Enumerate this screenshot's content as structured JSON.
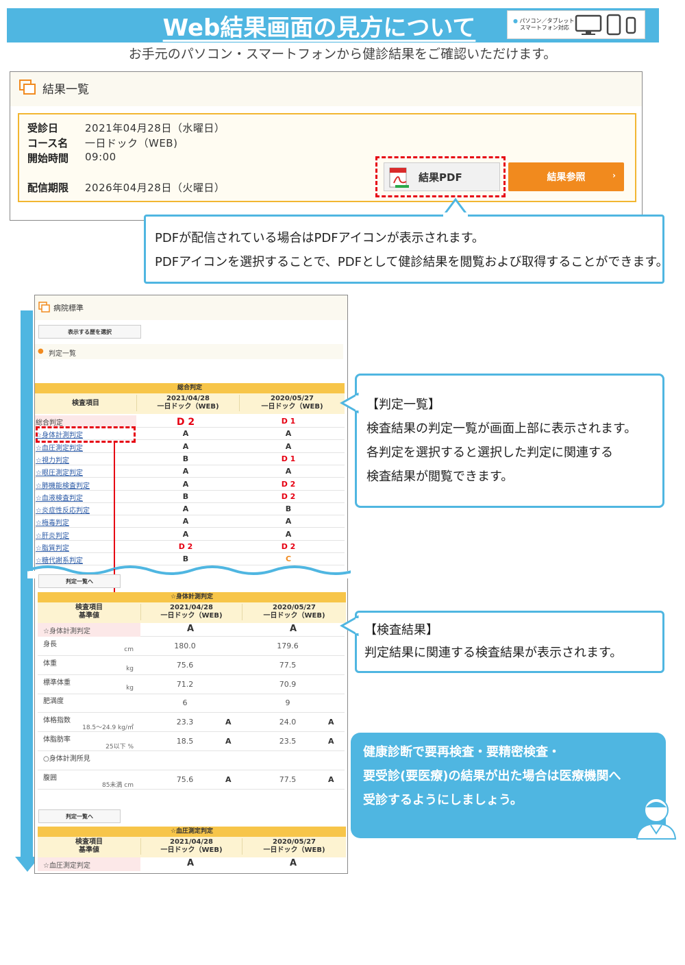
{
  "header": {
    "title": "Web結果画面の見方について",
    "badge": [
      "パソコン／タブレット",
      "スマートフォン対応"
    ],
    "subtitle": "お手元のパソコン・スマートフォンから健診結果をご確認いただけます。"
  },
  "panel1": {
    "title": "結果一覧",
    "rows": [
      {
        "label": "受診日",
        "value": "2021年04月28日（水曜日）"
      },
      {
        "label": "コース名",
        "value": "一日ドック（WEB)"
      },
      {
        "label": "開始時間",
        "value": "09:00"
      },
      {
        "label": "配信期限",
        "value": "2026年04月28日（火曜日）"
      }
    ],
    "pdf_button": "結果PDF",
    "ref_button": "結果参照",
    "ref_arrow": "›"
  },
  "callout1": {
    "lines": [
      "PDFが配信されている場合はPDFアイコンが表示されます。",
      "PDFアイコンを選択することで、PDFとして健診結果を閲覧および取得することができます。"
    ]
  },
  "callout2": {
    "lines": [
      "【判定一覧】",
      "検査結果の判定一覧が画面上部に表示されます。",
      "各判定を選択すると選択した判定に関連する",
      "検査結果が閲覧できます。"
    ]
  },
  "callout3": {
    "lines": [
      "【検査結果】",
      "判定結果に関連する検査結果が表示されます。"
    ]
  },
  "callout4": {
    "lines": [
      "健康診断で要再検査・要精密検査・",
      "要受診(要医療)の結果が出た場合は医療機関へ",
      "受診するようにしましょう。"
    ]
  },
  "panel2": {
    "title": "病院標準",
    "select_button": "表示する歴を選択",
    "section": "判定一覧",
    "summary": {
      "category": "総合判定",
      "col_item": "検査項目",
      "col1": [
        "2021/04/28",
        "一日ドック（WEB)"
      ],
      "col2": [
        "2020/05/27",
        "一日ドック（WEB)"
      ],
      "rows": [
        {
          "name": "総合判定",
          "v1": "D 2",
          "v2": "D 1"
        },
        {
          "name": "☆身体計測判定",
          "v1": "A",
          "v2": "A"
        },
        {
          "name": "☆血圧測定判定",
          "v1": "A",
          "v2": "A"
        },
        {
          "name": "☆視力判定",
          "v1": "B",
          "v2": "D 1"
        },
        {
          "name": "☆眼圧測定判定",
          "v1": "A",
          "v2": "A"
        },
        {
          "name": "☆肺機能検査判定",
          "v1": "A",
          "v2": "D 2"
        },
        {
          "name": "☆血液検査判定",
          "v1": "B",
          "v2": "D 2"
        },
        {
          "name": "☆炎症性反応判定",
          "v1": "A",
          "v2": "B"
        },
        {
          "name": "☆梅毒判定",
          "v1": "A",
          "v2": "A"
        },
        {
          "name": "☆肝炎判定",
          "v1": "A",
          "v2": "A"
        },
        {
          "name": "☆脂質判定",
          "v1": "D 2",
          "v2": "D 2"
        },
        {
          "name": "☆糖代謝系判定",
          "v1": "B",
          "v2": "C"
        }
      ]
    },
    "back_button": "判定一覧へ",
    "body": {
      "category": "☆身体計測判定",
      "col_item": "検査項目",
      "col_std": "基準値",
      "judge_row": {
        "name": "☆身体計測判定",
        "v1": "A",
        "v2": "A"
      },
      "rows": [
        {
          "name": "身長",
          "unit": "cm",
          "v1": "180.0",
          "j1": "",
          "v2": "179.6",
          "j2": ""
        },
        {
          "name": "体重",
          "unit": "kg",
          "v1": "75.6",
          "j1": "",
          "v2": "77.5",
          "j2": ""
        },
        {
          "name": "標準体重",
          "unit": "kg",
          "v1": "71.2",
          "j1": "",
          "v2": "70.9",
          "j2": ""
        },
        {
          "name": "肥満度",
          "unit": "",
          "v1": "6",
          "j1": "",
          "v2": "9",
          "j2": ""
        },
        {
          "name": "体格指数",
          "unit": "18.5～24.9 kg/㎡",
          "v1": "23.3",
          "j1": "A",
          "v2": "24.0",
          "j2": "A"
        },
        {
          "name": "体脂肪率",
          "unit": "25以下 %",
          "v1": "18.5",
          "j1": "A",
          "v2": "23.5",
          "j2": "A"
        },
        {
          "name": "○身体計測所見",
          "unit": "",
          "v1": "",
          "j1": "",
          "v2": "",
          "j2": ""
        },
        {
          "name": "腹囲",
          "unit": "85未満 cm",
          "v1": "75.6",
          "j1": "A",
          "v2": "77.5",
          "j2": "A"
        }
      ]
    },
    "bp": {
      "category": "☆血圧測定判定",
      "judge_row": {
        "name": "☆血圧測定判定",
        "v1": "A",
        "v2": "A"
      }
    }
  },
  "colors": {
    "accent_blue": "#4fb6e1",
    "orange": "#f18a1e",
    "red": "#e60012",
    "yellow": "#f7c549"
  }
}
